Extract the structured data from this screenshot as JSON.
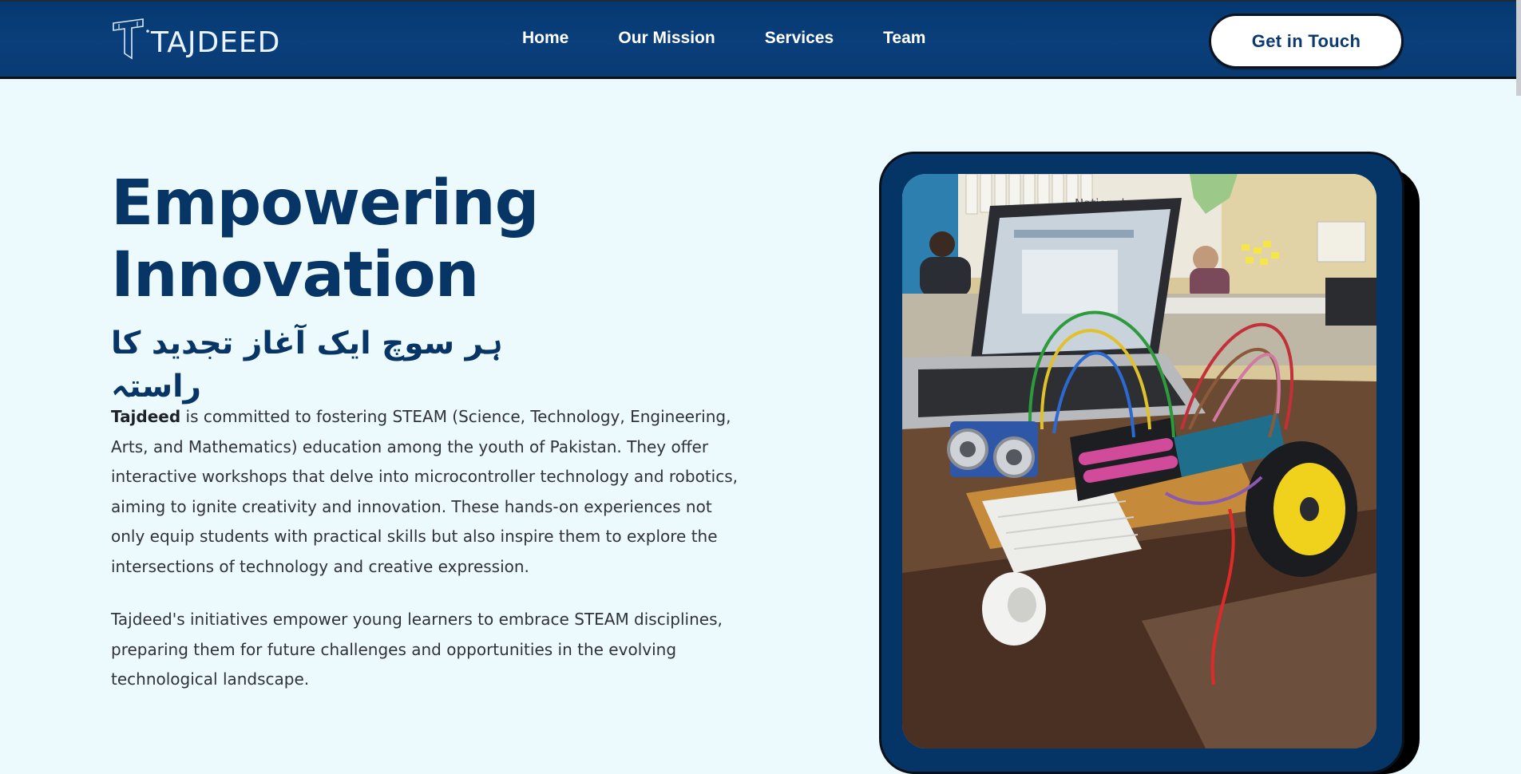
{
  "header": {
    "logo_text": "TAJDEED",
    "logo_icon": "t-mark-icon",
    "nav": [
      {
        "label": "Home"
      },
      {
        "label": "Our Mission"
      },
      {
        "label": "Services"
      },
      {
        "label": "Team"
      }
    ],
    "cta_label": "Get in Touch"
  },
  "hero": {
    "title_line1": "Empowering",
    "title_line2": "Innovation",
    "urdu_tagline": "ہر سوچ ایک آغاز تجدید کا راستہ",
    "paragraph1_brand": "Tajdeed",
    "paragraph1_rest": " is committed to fostering STEAM (Science, Technology, Engineering, Arts, and Mathematics) education among the youth of Pakistan. They offer interactive workshops that delve into microcontroller technology and robotics, aiming to ignite creativity and innovation. These hands-on experiences not only equip students with practical skills but also inspire them to explore the intersections of technology and creative expression.",
    "paragraph2": "Tajdeed's initiatives empower young learners to embrace STEAM disciplines, preparing them for future challenges and opportunities in the evolving technological landscape.",
    "image_subject": "robot-car-workshop-photo",
    "wall_poster_text": "National"
  },
  "colors": {
    "navy": "#073565",
    "header_bg": "#0a3f7b",
    "page_bg": "#ecfafd",
    "text": "#2f3338",
    "cta_bg": "#ffffff"
  }
}
